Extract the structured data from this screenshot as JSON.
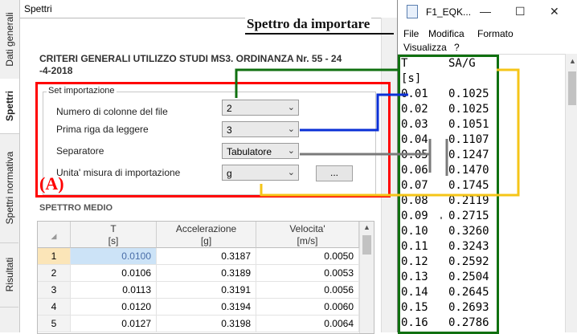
{
  "tabs": [
    "Dati generali",
    "Spettri",
    "Spettri normativa",
    "Risultati"
  ],
  "top_bar": {
    "title": "Spettri"
  },
  "main_title_line1": "CRITERI GENERALI UTILIZZO STUDI MS3. ORDINANZA Nr. 55 - 24",
  "main_title_line2": "-4-2018",
  "import_settings": {
    "group_title": "Set importazione",
    "fields": [
      {
        "label": "Numero di colonne del file",
        "value": "2"
      },
      {
        "label": "Prima riga da leggere",
        "value": "3"
      },
      {
        "label": "Separatore",
        "value": "Tabulatore"
      },
      {
        "label": "Unita' misura di importazione",
        "value": "g"
      }
    ],
    "browse_button": "..."
  },
  "annotation": {
    "label_a": "(A)",
    "title": "Spettro da importare",
    "colors": {
      "red": "#ff0000",
      "green": "#107010",
      "blue": "#0a2fd6",
      "gray": "#7a7a7a",
      "yellow": "#f5c518"
    }
  },
  "spectrum": {
    "title": "SPETTRO MEDIO",
    "columns": [
      {
        "name": "T",
        "unit": "[s]"
      },
      {
        "name": "Accelerazione",
        "unit": "[g]"
      },
      {
        "name": "Velocita'",
        "unit": "[m/s]"
      }
    ],
    "rows": [
      {
        "index": "1",
        "t": "0.0100",
        "acc": "0.3187",
        "vel": "0.0050"
      },
      {
        "index": "2",
        "t": "0.0106",
        "acc": "0.3189",
        "vel": "0.0053"
      },
      {
        "index": "3",
        "t": "0.0113",
        "acc": "0.3191",
        "vel": "0.0056"
      },
      {
        "index": "4",
        "t": "0.0120",
        "acc": "0.3194",
        "vel": "0.0060"
      },
      {
        "index": "5",
        "t": "0.0127",
        "acc": "0.3198",
        "vel": "0.0064"
      }
    ]
  },
  "notepad": {
    "title": "F1_EQK...",
    "window_buttons": {
      "minimize": "—",
      "maximize": "☐",
      "close": "✕"
    },
    "menu": [
      "File",
      "Modifica",
      "Formato",
      "Visualizza",
      "?"
    ],
    "lines": [
      "T      SA/G",
      "[s]",
      "0.01   0.1025",
      "0.02   0.1025",
      "0.03   0.1051",
      "0.04   0.1107",
      "0.05   0.1247",
      "0.06   0.1470",
      "0.07   0.1745",
      "0.08   0.2119",
      "0.09   0.2715",
      "0.10   0.3260",
      "0.11   0.3243",
      "0.12   0.2592",
      "0.13   0.2504",
      "0.14   0.2645",
      "0.15   0.2693",
      "0.16   0.2786"
    ]
  }
}
